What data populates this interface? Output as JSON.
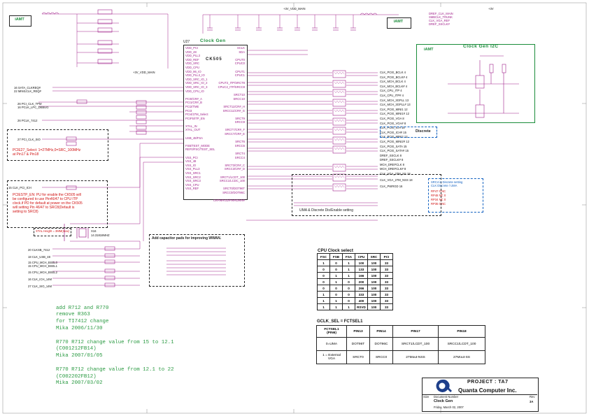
{
  "blocks": {
    "iamt_left": "iAMT",
    "iamt_right": "iAMT",
    "iamt_i2c": "iAMT",
    "clock_gen_title": "Clock Gen",
    "clock_gen_i2c_title": "Clock Gen I2C",
    "chip_name": "CK505",
    "chip_ref": "U27",
    "crystal_ref": "X16",
    "crystal_freq": "14.31818MHZ",
    "discrete_label": "Discrete",
    "uma_discrete_note": "UMA & Discrete Dis/Enable setting",
    "capacitor_pads_title": "Add capacitor pads for improving WWAN.",
    "pcie_note": "PCIE27_Select: 1=27MHz,0=SRC_100MHz\nat Pin17 & Pin18",
    "pcie_stop_note": "PCIESTP_EN: PU for enable the CK505 will\nbe configured to use Pin46/47 to CPU ITP\nclock.if PD for default at power on the CK505\nwill setting Pin 46/47 to SRC8(Default is\nsetting to SRC8)",
    "xtal_note": "XTAL Height = 3MM(max)",
    "power_net_top": "+3V_VDD_MAIN",
    "power_net_3v": "+3V",
    "power_net_clk": "+3V_VDD_MAIN"
  },
  "right_note": {
    "title": "SRC4 is Discrete setting",
    "subtitle": "CLK    Discrete / UMA",
    "rows": [
      {
        "ref": "RP47",
        "a": "0",
        "b": "NC"
      },
      {
        "ref": "RP48",
        "a": "NC",
        "b": "0"
      },
      {
        "ref": "RP34",
        "a": "NC",
        "b": "0"
      },
      {
        "ref": "RP35",
        "a": "0",
        "b": "NC"
      }
    ]
  },
  "cpu_clock_table": {
    "title": "CPU Clock select",
    "headers": [
      "FSC",
      "FSB",
      "FSA",
      "CPU",
      "SRC",
      "PCI"
    ],
    "rows": [
      [
        "1",
        "0",
        "1",
        "100",
        "100",
        "33"
      ],
      [
        "0",
        "0",
        "1",
        "133",
        "100",
        "33"
      ],
      [
        "0",
        "1",
        "1",
        "166",
        "100",
        "33"
      ],
      [
        "0",
        "1",
        "0",
        "200",
        "100",
        "33"
      ],
      [
        "0",
        "0",
        "0",
        "266",
        "100",
        "33"
      ],
      [
        "1",
        "0",
        "0",
        "333",
        "100",
        "33"
      ],
      [
        "1",
        "1",
        "0",
        "400",
        "100",
        "33"
      ],
      [
        "1",
        "1",
        "1",
        "RSVD",
        "100",
        "33"
      ]
    ]
  },
  "gclk_table": {
    "title": "GCLK_SEL = FCTSEL1",
    "headers": [
      "FCTSEL1\n(PIN6)",
      "PIN13",
      "PIN14",
      "PIN17",
      "PIN18"
    ],
    "rows": [
      [
        "0=UMA",
        "DOT96T",
        "DOT96C",
        "SRCT1/LCDT_100",
        "SRCC1/LCDT_100"
      ],
      [
        "1 = External\nVGA",
        "SRCT0",
        "SRCC0",
        "27Mout-NSS",
        "27Mout-SS"
      ]
    ]
  },
  "change_log": [
    "add R712 and R770",
    "remove R363",
    "for TI7412 change",
    "Mika 2006/11/30",
    "",
    "R770 R712 change value from 15 to 12.1",
    "(C001212FB14)",
    "Mika 2007/01/05",
    "",
    "R770 R712 change value from 12.1 to 22",
    "(C002202FB12)",
    "Mika 2007/03/02"
  ],
  "title_block": {
    "project_label": "PROJECT : TA7",
    "company": "Quanta Computer Inc.",
    "sheet_title": "Clock Gen",
    "rev": "3A",
    "date": "Friday, March 02, 2007",
    "size_label": "Size",
    "doc_label": "Document Number",
    "rev_label": "Rev"
  },
  "chip_left_pins": [
    "VDD_PCI",
    "VDD_48",
    "VDD_PLL3",
    "VDD_REF",
    "VDD_SRC",
    "VDD_CPU",
    "VDD_96_IO",
    "VDD_PLL3_IO",
    "VDD_SRC_IO_1",
    "VDD_SRC_IO_2",
    "VDD_SRC_IO_3",
    "VDD_CPU_IO",
    "",
    "PCI0/CR#_A",
    "PCI1/CR#_B",
    "PCI2/TME",
    "PCI3",
    "PCI4/27M_Select",
    "PCIF5/ITP_EN",
    "",
    "XTAL_IN",
    "XTAL_OUT",
    "",
    "USB_48/FSA",
    "",
    "FSB/TEST_MODE",
    "REF0/FSC/TEST_SEL",
    "",
    "VSS_PCI",
    "VSS_48",
    "VSS_IO",
    "VSS_PLL3",
    "VSS_SRC1",
    "VSS_SRC2",
    "VSS_SRC3",
    "VSS_CPU",
    "VSS_REF"
  ],
  "chip_right_pins": [
    "SCLK",
    "SDA",
    "",
    "CPUT0",
    "CPUC0",
    "",
    "CPUT1",
    "CPUC1",
    "",
    "CPUT2_ITP/SRCT8",
    "CPUC2_ITP/SRCC8",
    "",
    "SRCT10",
    "SRCC10",
    "",
    "SRCT11/CR#_H",
    "SRCC11/CR#_G",
    "",
    "SRCT9",
    "SRCC9",
    "",
    "SRCT7/CR#_F",
    "SRCC7/CR#_E",
    "",
    "SRCT6",
    "SRCC6",
    "",
    "SRCT4",
    "SRCC4",
    "",
    "SRCT3/CR#_C",
    "SRCC3/CR#_D",
    "",
    "SRCT1/LCDT_100",
    "SRCC1/LCDC_100",
    "",
    "SRCT0/DOT96T",
    "SRCC0/DOT96C",
    "",
    "CKPWRGD/PWRDWN#"
  ],
  "right_outputs": [
    {
      "ref": "RP43",
      "sig": "CLK_PCIE_BCLK",
      "n": "4"
    },
    {
      "ref": "RP43",
      "sig": "CLK_PCIE_BCLK#",
      "n": "4"
    },
    {
      "ref": "RP44",
      "sig": "CLK_MCH_BCLK",
      "n": "4"
    },
    {
      "ref": "RP44",
      "sig": "CLK_MCH_BCLK#",
      "n": "4"
    },
    {
      "ref": "RP45",
      "sig": "CLK_CPU_ITP",
      "n": "4"
    },
    {
      "ref": "RP45",
      "sig": "CLK_CPU_ITP#",
      "n": "4"
    },
    {
      "ref": "RP46",
      "sig": "CLK_MCH_3GPLL",
      "n": "13"
    },
    {
      "ref": "RP46",
      "sig": "CLK_MCH_3GPLL#",
      "n": "13"
    },
    {
      "ref": "RP47",
      "sig": "CLK_PCIE_MINI1",
      "n": "12"
    },
    {
      "ref": "RP47",
      "sig": "CLK_PCIE_MINI1#",
      "n": "12"
    },
    {
      "ref": "RP48",
      "sig": "CLK_PCIE_VGA",
      "n": "8"
    },
    {
      "ref": "RP48",
      "sig": "CLK_PCIE_VGA#",
      "n": "8"
    },
    {
      "ref": "RP49",
      "sig": "CLK_PCIE_ICH",
      "n": "15"
    },
    {
      "ref": "RP49",
      "sig": "CLK_PCIE_ICH#",
      "n": "15"
    },
    {
      "ref": "RP50",
      "sig": "CLK_PCIE_MINI2",
      "n": "12"
    },
    {
      "ref": "RP50",
      "sig": "CLK_PCIE_MINI2#",
      "n": "12"
    },
    {
      "ref": "RP34",
      "sig": "CLK_PCIE_SATA",
      "n": "15"
    },
    {
      "ref": "RP34",
      "sig": "CLK_PCIE_SATA#",
      "n": "15"
    },
    {
      "ref": "RP35",
      "sig": "DREF_SSCLK",
      "n": "8"
    },
    {
      "ref": "RP35",
      "sig": "DREF_SSCLK#",
      "n": "8"
    },
    {
      "ref": "RP36",
      "sig": "MCH_DREFCLK",
      "n": "8"
    },
    {
      "ref": "RP36",
      "sig": "MCH_DREFCLK#",
      "n": "8"
    },
    {
      "ref": "",
      "sig": "CLK_VGA_27M_SS",
      "n": "18"
    },
    {
      "ref": "",
      "sig": "CLK_VGA_27M_NSS",
      "n": "18"
    },
    {
      "ref": "",
      "sig": "CLK_PWRGD",
      "n": "16"
    }
  ],
  "left_signals": [
    "16 SATA_CLKREQ#",
    "22 MINI1CLK_REQ#",
    "26 PCI_CLK_TPM",
    "16 PCLK_LPC_DEBUG",
    "26 PCLK_7412",
    "27 PCI_CLK_SIO",
    "15 CLK_PCI_ICH",
    "20 CLKSB_7412",
    "18 CLK_USB_48",
    "15 CPU_MCH_BSEL0",
    "15 CPU_MCH_BSEL1",
    "15 CPU_MCH_BSEL2",
    "16 CLK_ICH_14M",
    "27 CLK_SIO_14M"
  ],
  "top_right_signals": [
    "DREF_CLK_MAIN",
    "SMBCLK_TRUNK",
    "CLK_VGA_REF",
    "DREF_SSCLK#"
  ]
}
